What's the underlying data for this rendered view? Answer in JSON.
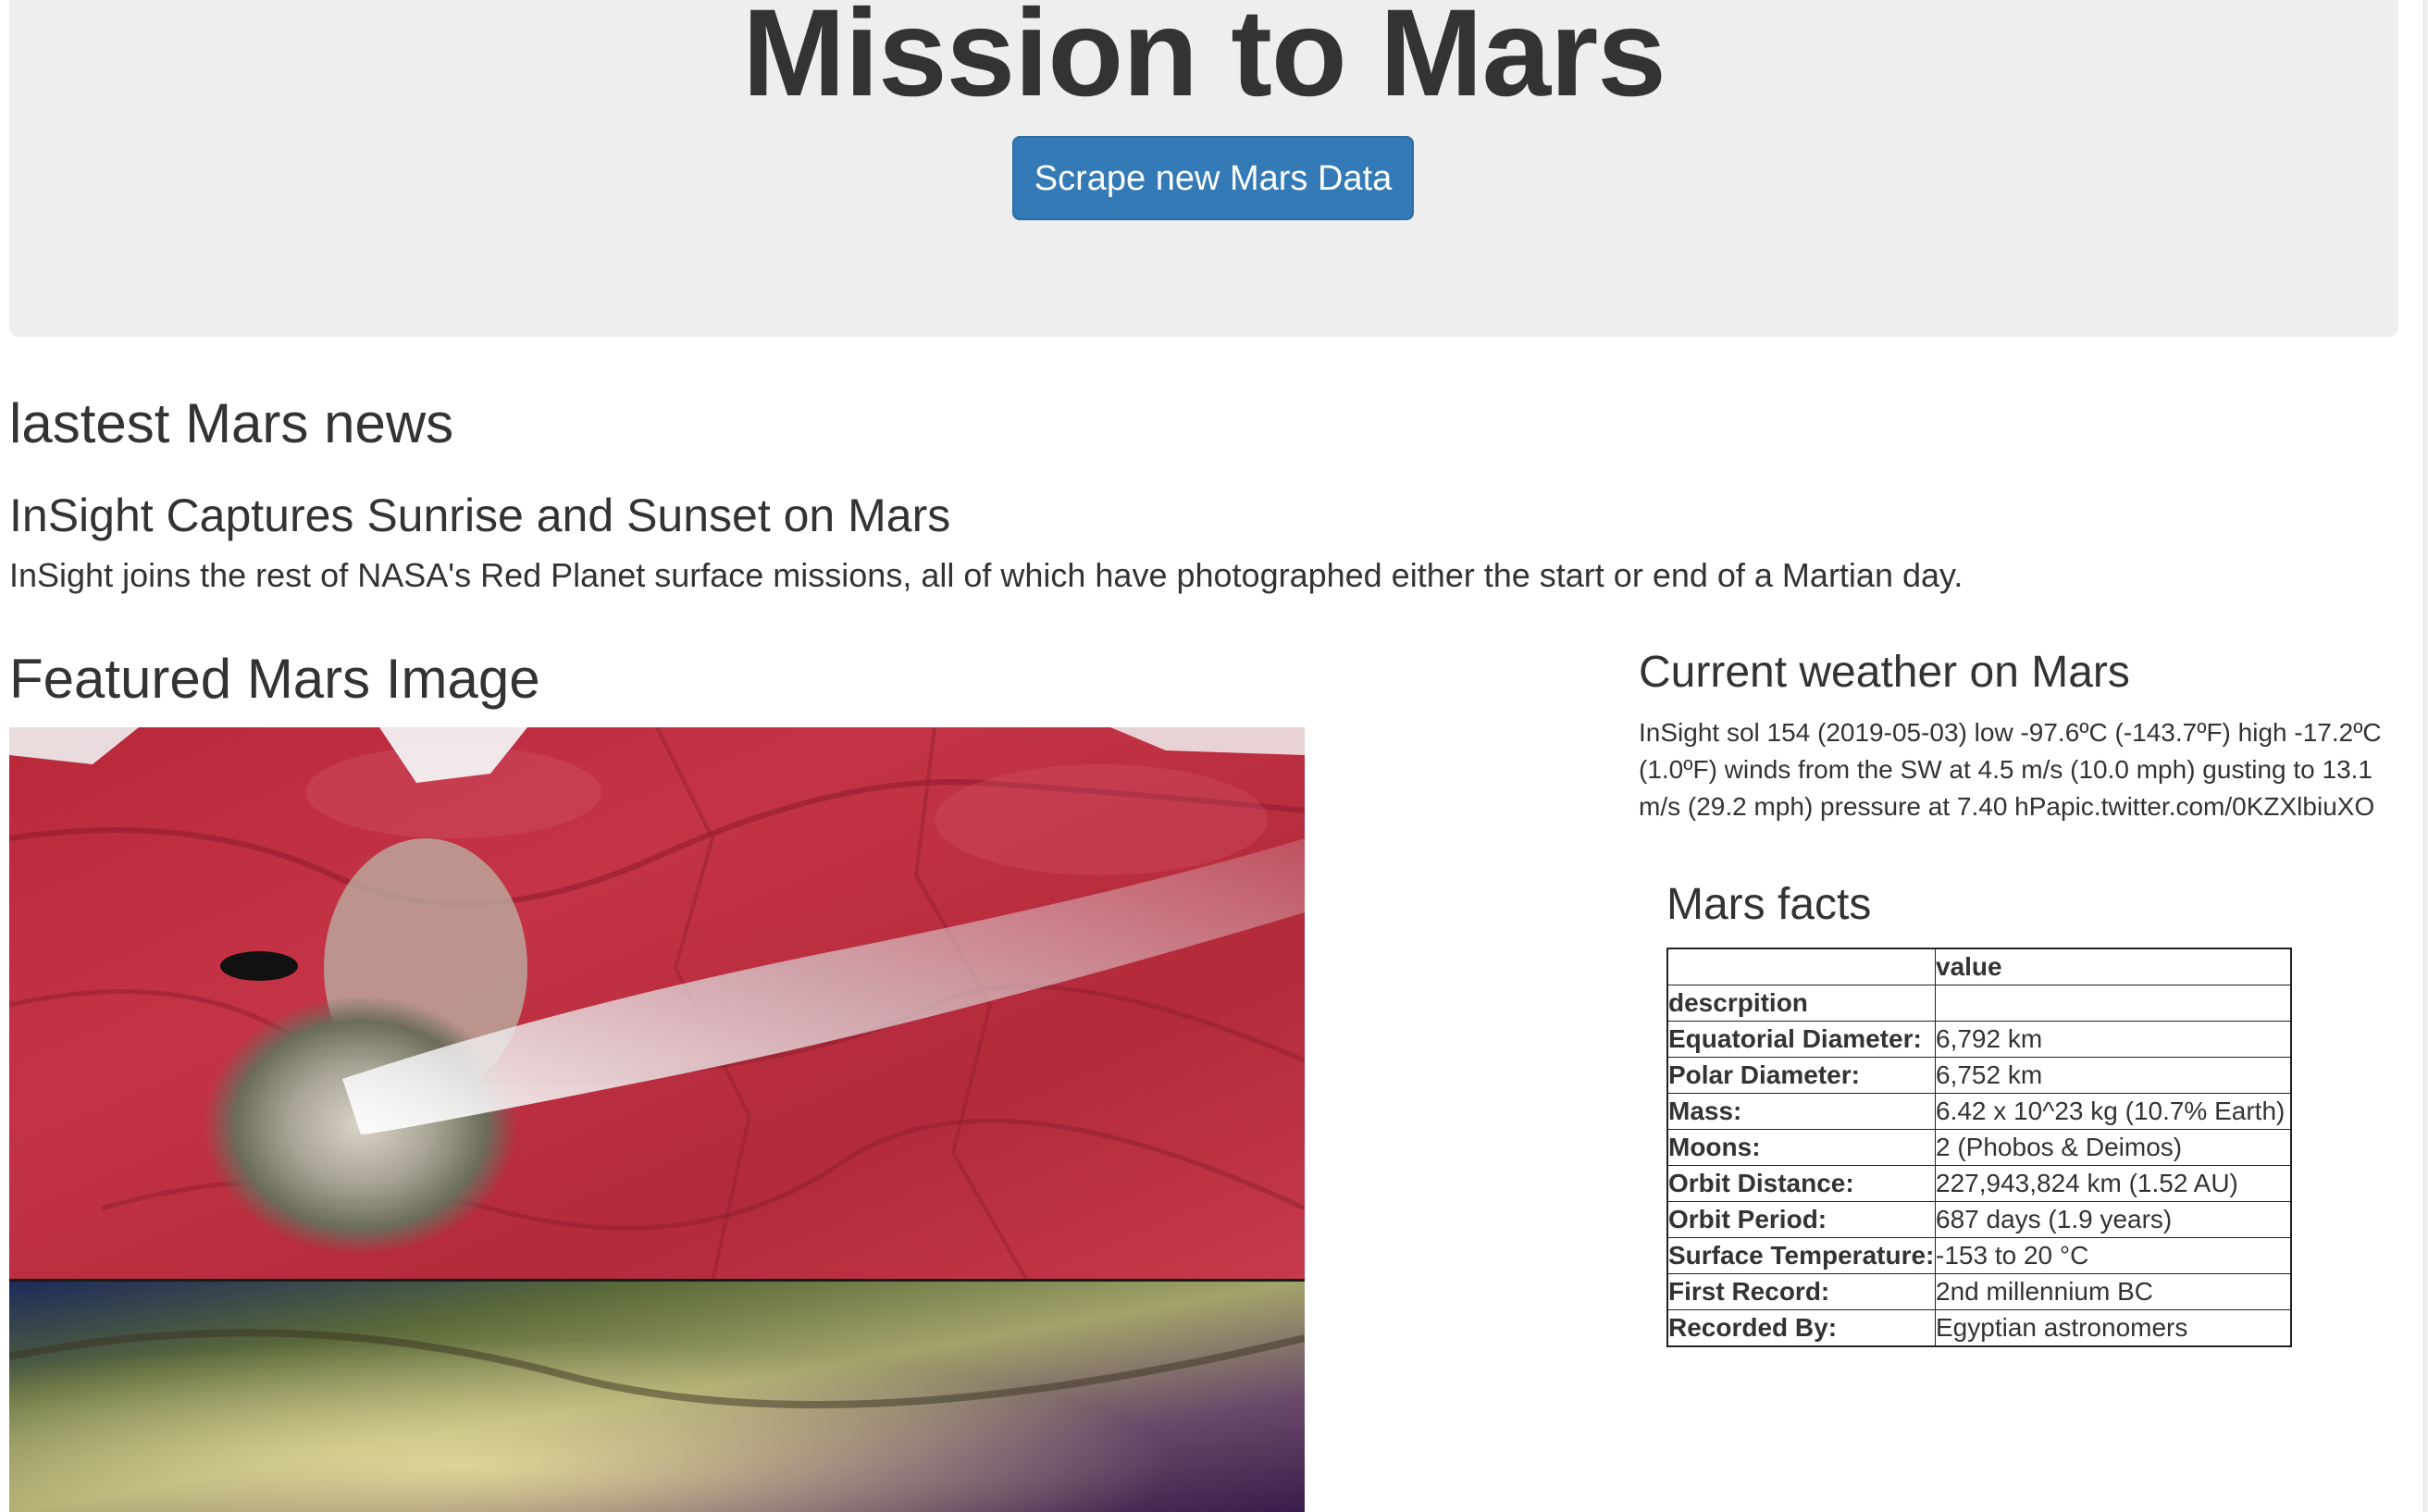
{
  "header": {
    "title": "Mission to Mars",
    "scrape_button_label": "Scrape new Mars Data"
  },
  "news": {
    "heading": "lastest Mars news",
    "title": "InSight Captures Sunrise and Sunset on Mars",
    "teaser": "InSight joins the rest of NASA's Red Planet surface missions, all of which have photographed either the start or end of a Martian day."
  },
  "featured": {
    "heading": "Featured Mars Image"
  },
  "weather": {
    "heading": "Current weather on Mars",
    "text": "InSight sol 154 (2019-05-03) low -97.6ºC (-143.7ºF) high -17.2ºC (1.0ºF) winds from the SW at 4.5 m/s (10.0 mph) gusting to 13.1 m/s (29.2 mph) pressure at 7.40 hPapic.twitter.com/0KZXlbiuXO"
  },
  "facts": {
    "heading": "Mars facts",
    "header_row": [
      "",
      "value"
    ],
    "index_label": "descrpition",
    "rows": [
      {
        "label": "Equatorial Diameter:",
        "value": "6,792 km"
      },
      {
        "label": "Polar Diameter:",
        "value": "6,752 km"
      },
      {
        "label": "Mass:",
        "value": "6.42 x 10^23 kg (10.7% Earth)"
      },
      {
        "label": "Moons:",
        "value": "2 (Phobos & Deimos)"
      },
      {
        "label": "Orbit Distance:",
        "value": "227,943,824 km (1.52 AU)"
      },
      {
        "label": "Orbit Period:",
        "value": "687 days (1.9 years)"
      },
      {
        "label": "Surface Temperature:",
        "value": "-153 to 20 °C"
      },
      {
        "label": "First Record:",
        "value": "2nd millennium BC"
      },
      {
        "label": "Recorded By:",
        "value": "Egyptian astronomers"
      }
    ]
  },
  "colors": {
    "jumbotron_bg": "#eeeeee",
    "button_primary": "#337ab7",
    "text": "#333333"
  }
}
